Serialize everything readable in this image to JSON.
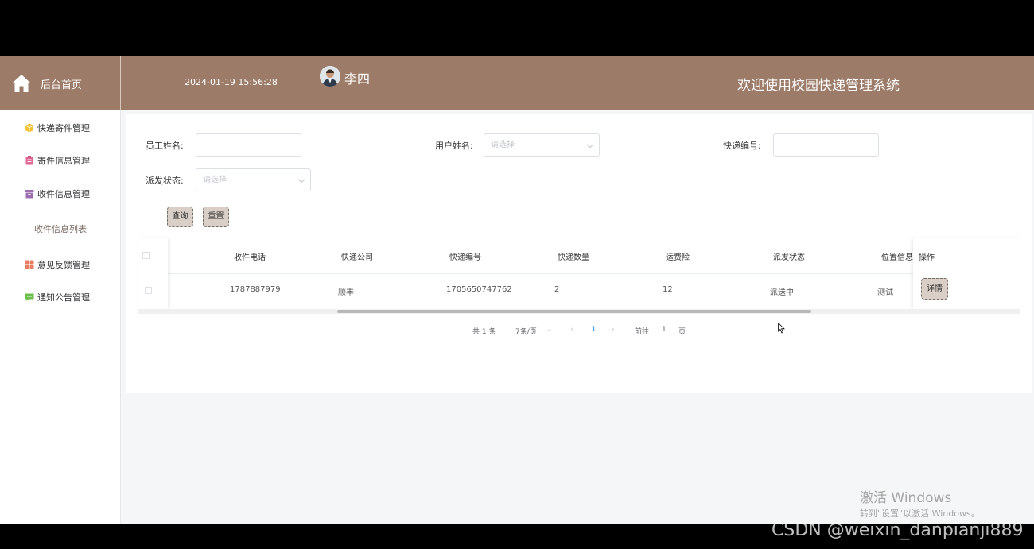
{
  "header": {
    "home_label": "后台首页",
    "datetime": "2024-01-19 15:56:28",
    "username": "李四",
    "welcome": "欢迎使用校园快递管理系统"
  },
  "sidebar": {
    "items": [
      {
        "label": "快递寄件管理",
        "icon": "cube-icon",
        "color": "#f1c232"
      },
      {
        "label": "寄件信息管理",
        "icon": "clipboard-icon",
        "color": "#e06694"
      },
      {
        "label": "收件信息管理",
        "icon": "archive-icon",
        "color": "#9c6fb0"
      },
      {
        "label": "意见反馈管理",
        "icon": "grid-icon",
        "color": "#e87d62"
      },
      {
        "label": "通知公告管理",
        "icon": "chat-icon",
        "color": "#6cc04a"
      }
    ],
    "submenu": "收件信息列表"
  },
  "search": {
    "employee_label": "员工姓名:",
    "user_label": "用户姓名:",
    "user_placeholder": "请选择",
    "tracking_label": "快递编号:",
    "status_label": "派发状态:",
    "status_placeholder": "请选择",
    "query_button": "查询",
    "reset_button": "重置"
  },
  "table": {
    "columns": [
      "收件电话",
      "快递公司",
      "快递编号",
      "快递数量",
      "运费险",
      "派发状态",
      "位置信息",
      "操作"
    ],
    "rows": [
      {
        "phone": "1787887979",
        "company": "顺丰",
        "tracking": "1705650747762",
        "quantity": "2",
        "insurance": "12",
        "status": "派送中",
        "location": "测试",
        "action": "详情"
      }
    ]
  },
  "pagination": {
    "total": "共 1 条",
    "page_size": "7条/页",
    "current_page": "1",
    "goto_label": "前往",
    "goto_value": "1",
    "page_unit": "页"
  },
  "overlay": {
    "activation_title": "激活 Windows",
    "activation_sub": "转到\"设置\"以激活 Windows。",
    "csdn": "CSDN @weixin_danpianji889"
  },
  "colors": {
    "header_bg": "#9c7b68",
    "accent": "#409eff",
    "button_bg": "#d9cfc6"
  }
}
